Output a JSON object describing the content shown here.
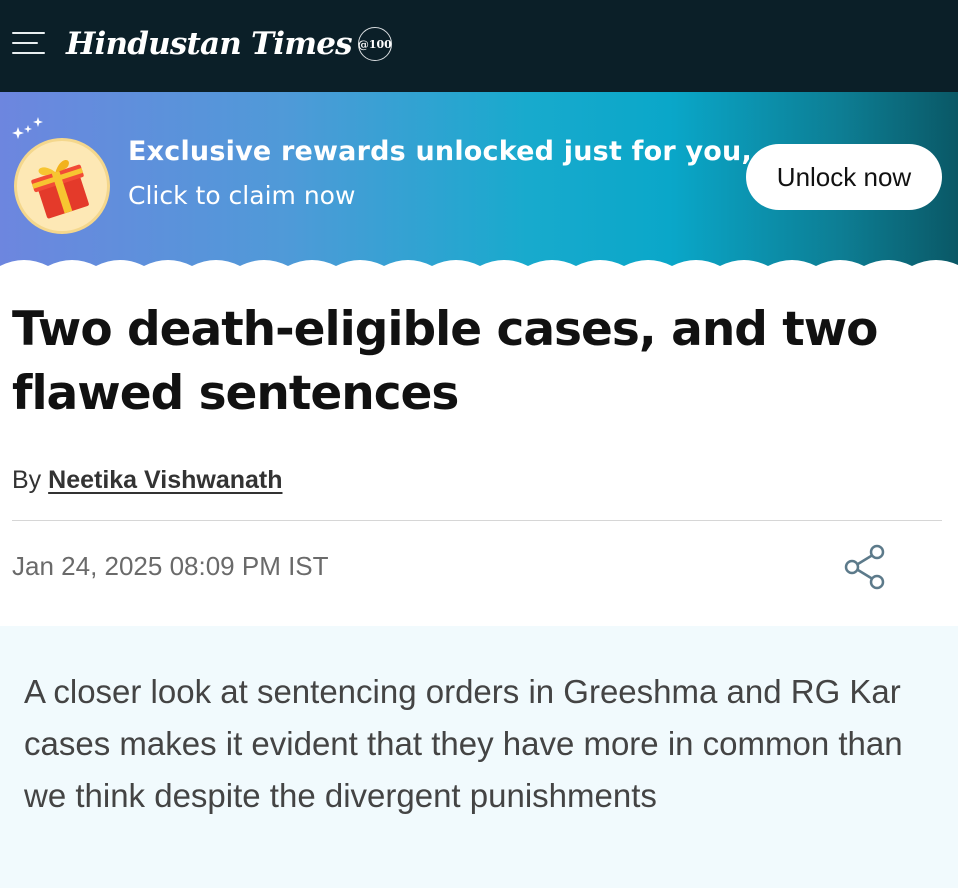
{
  "header": {
    "menu_icon": "hamburger-menu-icon",
    "logo_text": "Hindustan Times",
    "logo_badge": "@100",
    "background": "#0b1f28"
  },
  "banner": {
    "title": "Exclusive rewards unlocked just for you,",
    "subtitle": "Click to claim now",
    "button_label": "Unlock now",
    "icon": "gift-icon",
    "sparkle_icon": "sparkles-icon"
  },
  "article": {
    "headline": "Two death-eligible cases, and two flawed sentences",
    "by_label": "By",
    "author": "Neetika Vishwanath",
    "date": "Jan 24, 2025 08:09 PM IST",
    "share_icon": "share-icon",
    "summary": "A closer look at sentencing orders in Greeshma and RG Kar cases makes it evident that they have more in common than we think despite the divergent punishments"
  }
}
